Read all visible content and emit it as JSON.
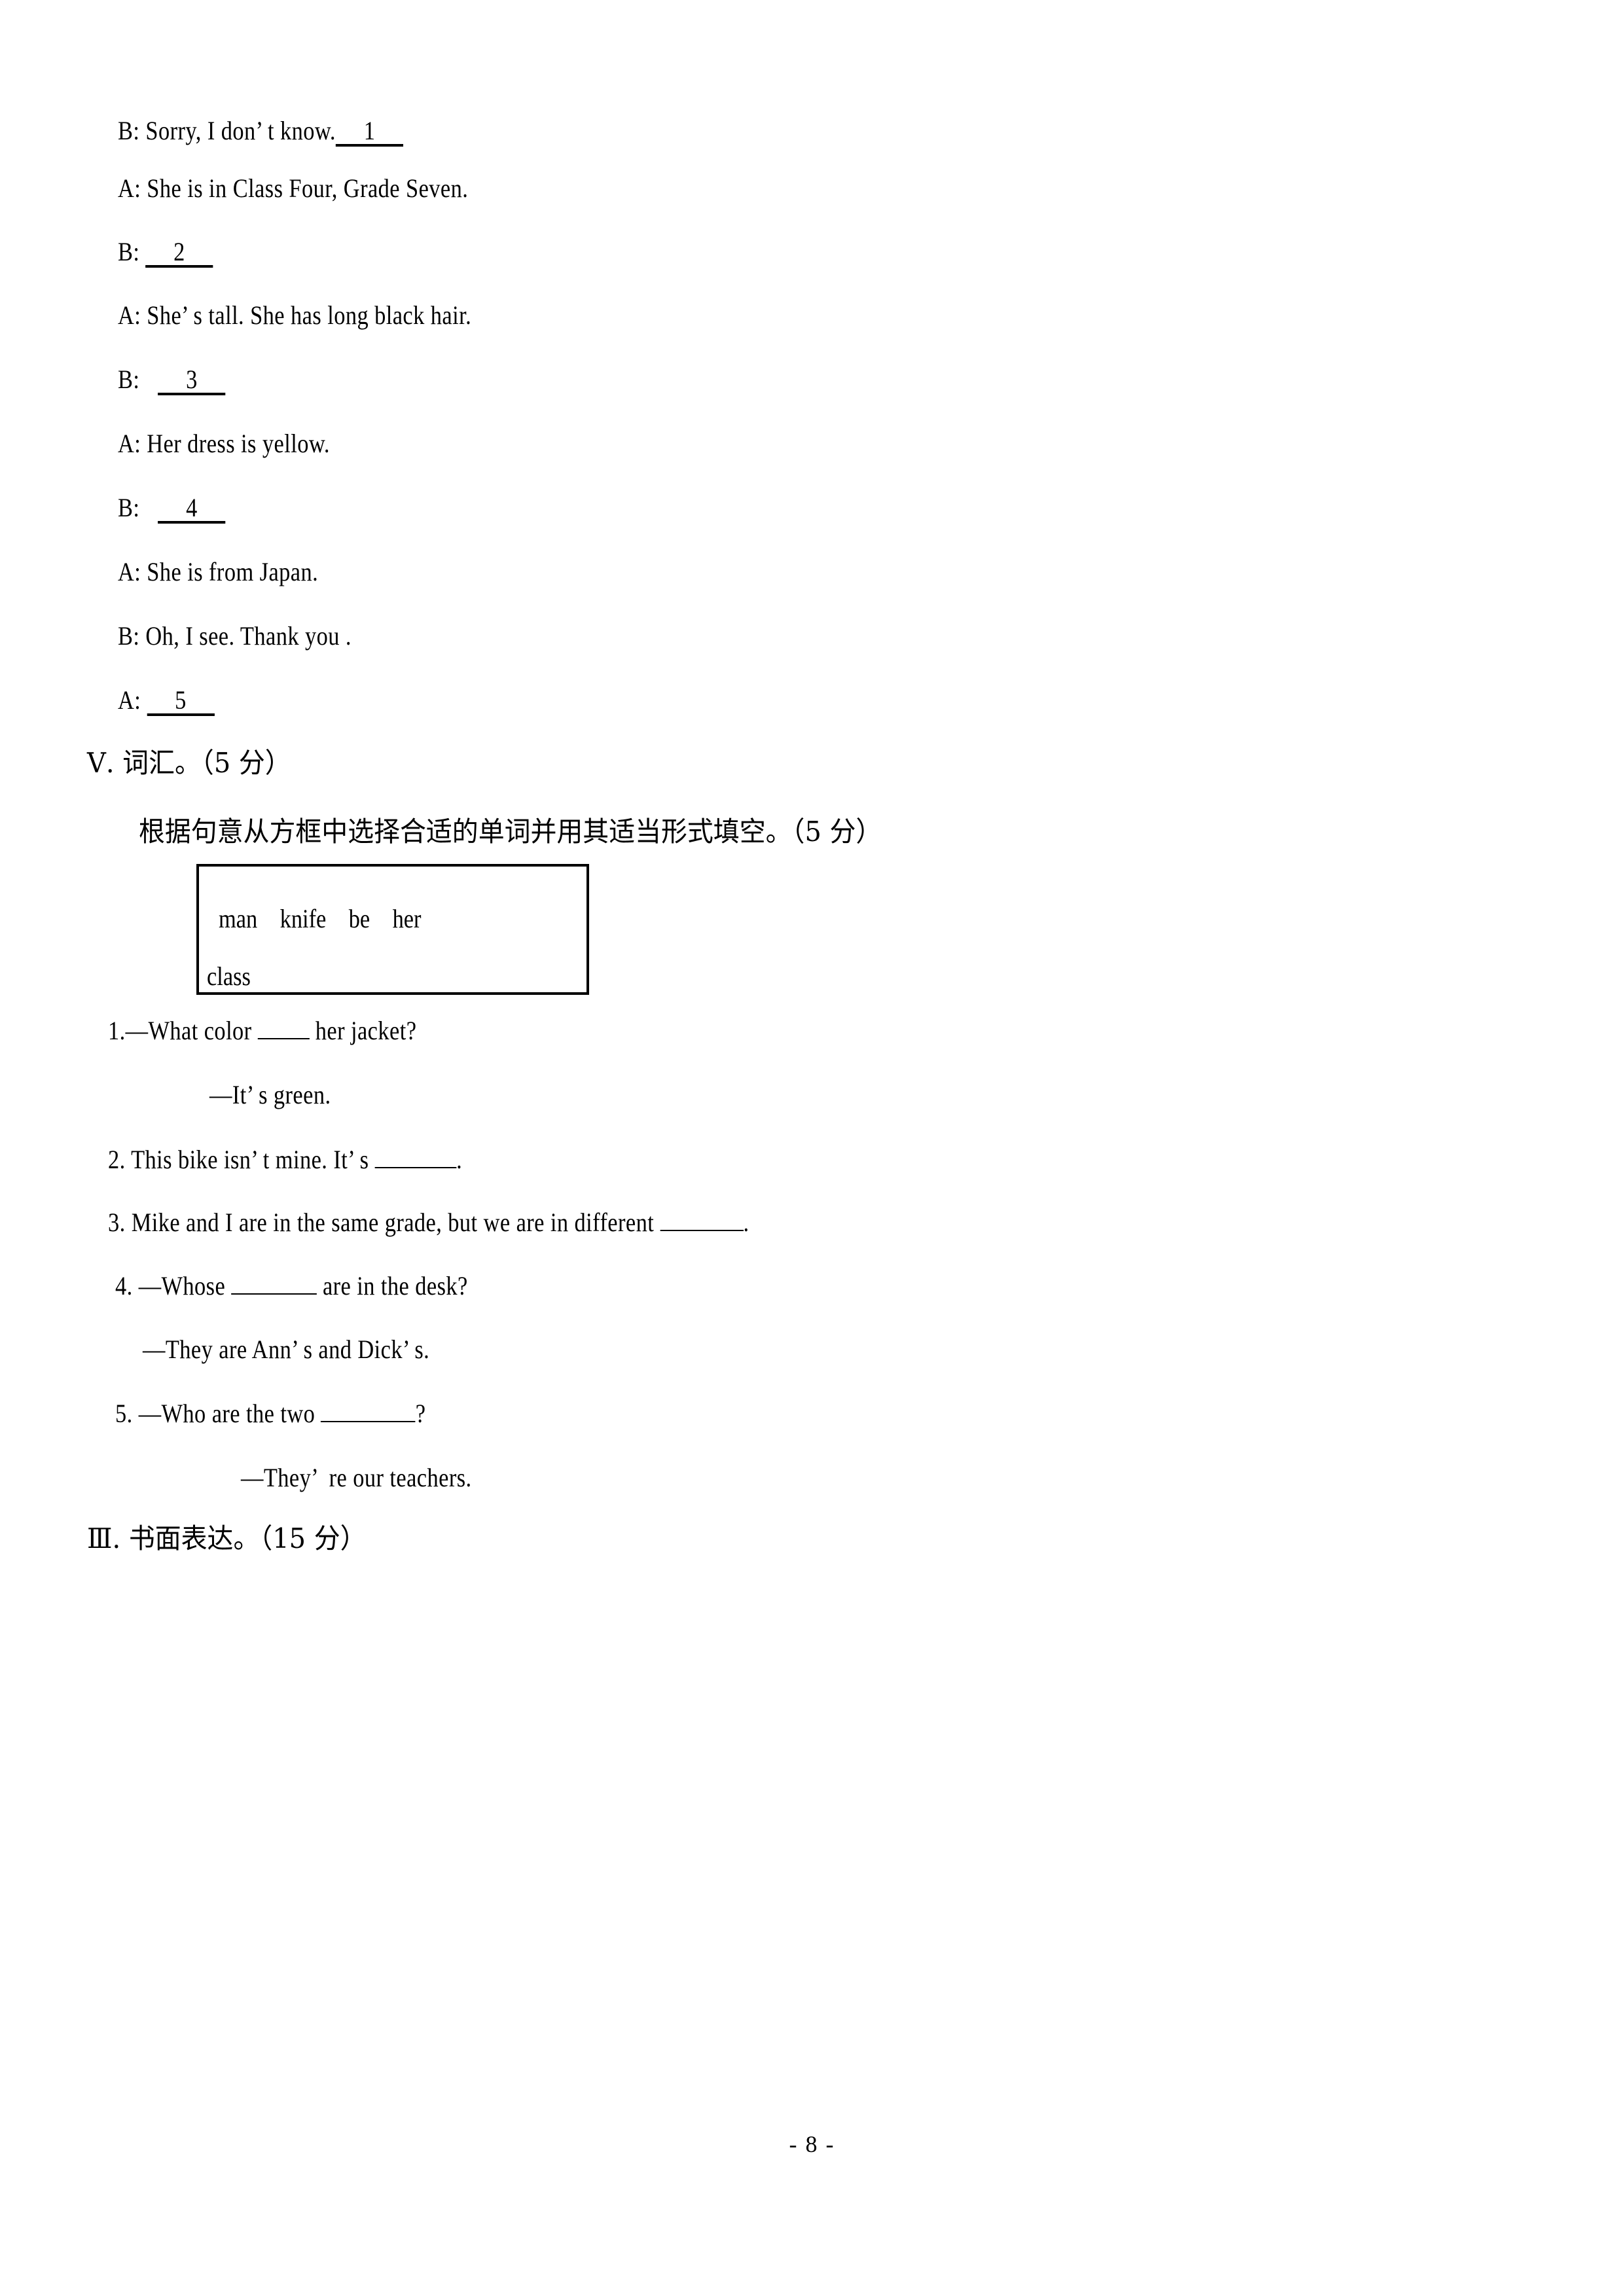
{
  "page": {
    "footer": "- 8 -"
  },
  "dialogue": {
    "lines": [
      {
        "speaker": "B: ",
        "text": "Sorry, I don’ t know.",
        "blank": "1"
      },
      {
        "speaker": "A: ",
        "text": "She is in Class Four, Grade Seven.",
        "blank": ""
      },
      {
        "speaker": "B: ",
        "text": "",
        "blank": "2"
      },
      {
        "speaker": "A: ",
        "text": "She’ s tall. She has long black hair.",
        "blank": ""
      },
      {
        "speaker": "B: ",
        "text": "",
        "blank": "3"
      },
      {
        "speaker": "A: ",
        "text": "Her dress is yellow.",
        "blank": ""
      },
      {
        "speaker": "B: ",
        "text": "",
        "blank": "4"
      },
      {
        "speaker": "A: ",
        "text": "She is from Japan.",
        "blank": ""
      },
      {
        "speaker": "B: ",
        "text": "Oh, I see. Thank you .",
        "blank": ""
      },
      {
        "speaker": "A: ",
        "text": "",
        "blank": "5"
      }
    ]
  },
  "vocab_section": {
    "heading": "Ⅴ. 词汇。（5 分）",
    "instruction": "根据句意从方框中选择合适的单词并用其适当形式填空。（5 分）",
    "word_bank": {
      "row1": [
        "man",
        "knife",
        "be",
        "her"
      ],
      "row2": [
        "class"
      ],
      "row1_text": "man    knife    be    her",
      "row2_text": "class"
    },
    "questions": [
      {
        "number": "1.",
        "prompt_pre": "—What color ",
        "prompt_post": " her jacket?",
        "answer": "—It’ s green."
      },
      {
        "number": "2. ",
        "prompt_pre": "This bike isn’ t mine. It’ s ",
        "prompt_post": ".",
        "answer": ""
      },
      {
        "number": "3. ",
        "prompt_pre": "Mike and I are in the same grade, but we are in different ",
        "prompt_post": ".",
        "answer": ""
      },
      {
        "number": "4. ",
        "prompt_pre": "—Whose ",
        "prompt_post": " are in the desk?",
        "answer": "—They are Ann’ s and Dick’ s."
      },
      {
        "number": "5. ",
        "prompt_pre": "—Who are the two ",
        "prompt_post": "?",
        "answer": "—They’  re our teachers."
      }
    ]
  },
  "writing_section": {
    "heading": "Ⅲ. 书面表达。（15 分）"
  }
}
